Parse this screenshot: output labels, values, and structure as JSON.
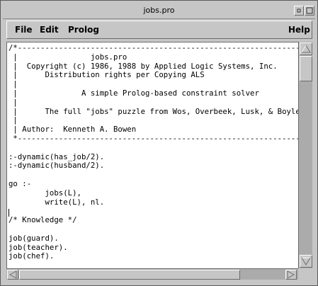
{
  "window": {
    "title": "jobs.pro"
  },
  "menubar": {
    "file": "File",
    "edit": "Edit",
    "prolog": "Prolog",
    "help": "Help"
  },
  "editor": {
    "lines": [
      "/*---------------------------------------------------------------",
      " |                jobs.pro",
      " |  Copyright (c) 1986, 1988 by Applied Logic Systems, Inc.",
      " |      Distribution rights per Copying ALS",
      " |",
      " |              A simple Prolog-based constraint solver",
      " |",
      " |      The full \"jobs\" puzzle from Wos, Overbeek, Lusk, & Boyle",
      " |",
      " | Author:  Kenneth A. Bowen",
      " *---------------------------------------------------------------",
      "",
      ":-dynamic(has_job/2).",
      ":-dynamic(husband/2).",
      "",
      "go :-",
      "        jobs(L),",
      "        write(L), nl.",
      "",
      "/* Knowledge */",
      "",
      "job(guard).",
      "job(teacher).",
      "job(chef)."
    ]
  }
}
